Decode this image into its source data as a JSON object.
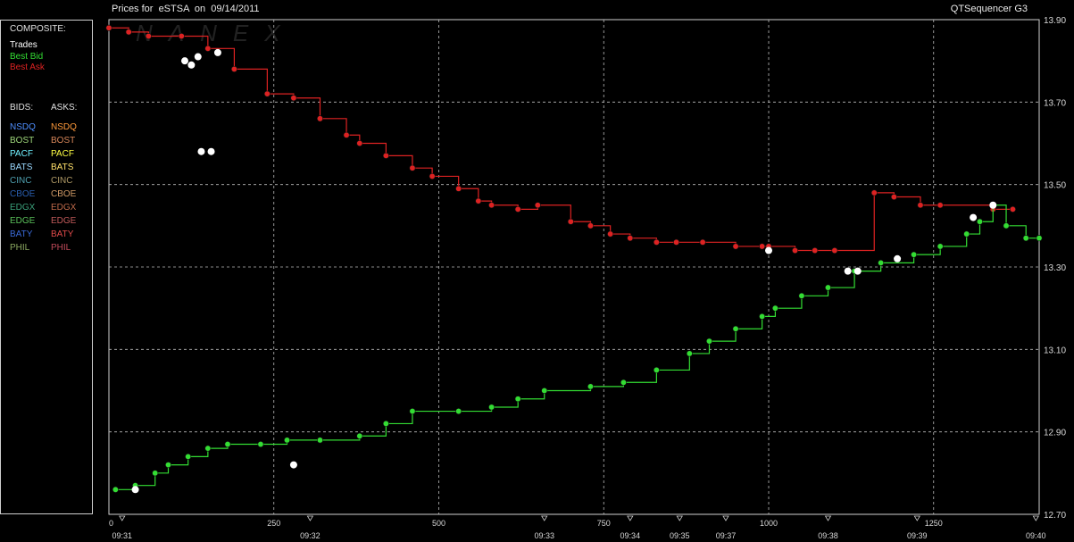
{
  "header": {
    "title": "Prices for  eSTSA  on  09/14/2011",
    "app_name": "QTSequencer G3"
  },
  "legend": {
    "composite_label": "COMPOSITE:",
    "composite": [
      {
        "label": "Trades",
        "color": "#ffffff"
      },
      {
        "label": "Best Bid",
        "color": "#33dd33"
      },
      {
        "label": "Best Ask",
        "color": "#dd2222"
      }
    ],
    "bids_label": "BIDS:",
    "asks_label": "ASKS:",
    "exchanges": [
      {
        "bid": "NSDQ",
        "ask": "NSDQ",
        "bid_color": "#4f8fff",
        "ask_color": "#ff9a3a"
      },
      {
        "bid": "BOST",
        "ask": "BOST",
        "bid_color": "#9ed67a",
        "ask_color": "#d8875a"
      },
      {
        "bid": "PACF",
        "ask": "PACF",
        "bid_color": "#6ff0ff",
        "ask_color": "#ffff44"
      },
      {
        "bid": "BATS",
        "ask": "BATS",
        "bid_color": "#9ad8ff",
        "ask_color": "#ffe06a"
      },
      {
        "bid": "CINC",
        "ask": "CINC",
        "bid_color": "#4fa0b0",
        "ask_color": "#b09a66"
      },
      {
        "bid": "CBOE",
        "ask": "CBOE",
        "bid_color": "#2a5fb0",
        "ask_color": "#d09a66"
      },
      {
        "bid": "EDGX",
        "ask": "EDGX",
        "bid_color": "#3aa07a",
        "ask_color": "#c06a4a"
      },
      {
        "bid": "EDGE",
        "ask": "EDGE",
        "bid_color": "#5ac05a",
        "ask_color": "#c05a5a"
      },
      {
        "bid": "BATY",
        "ask": "BATY",
        "bid_color": "#3a6ad8",
        "ask_color": "#e04a4a"
      },
      {
        "bid": "PHIL",
        "ask": "PHIL",
        "bid_color": "#8aa860",
        "ask_color": "#c04a5a"
      }
    ]
  },
  "chart_data": {
    "type": "line",
    "ylim": [
      12.7,
      13.9
    ],
    "y_ticks": [
      "13.90",
      "13.70",
      "13.50",
      "13.30",
      "13.10",
      "12.90",
      "12.70"
    ],
    "xlim": [
      0,
      1410
    ],
    "x_ticks": [
      "0",
      "250",
      "500",
      "750",
      "1000",
      "1250"
    ],
    "time_labels": [
      {
        "x": 20,
        "label": "09:31"
      },
      {
        "x": 305,
        "label": "09:32"
      },
      {
        "x": 660,
        "label": "09:33"
      },
      {
        "x": 790,
        "label": "09:34"
      },
      {
        "x": 865,
        "label": "09:35"
      },
      {
        "x": 935,
        "label": "09:37"
      },
      {
        "x": 1090,
        "label": "09:38"
      },
      {
        "x": 1225,
        "label": "09:39"
      },
      {
        "x": 1405,
        "label": "09:40"
      }
    ],
    "watermark": "NANEX",
    "series": [
      {
        "name": "Best Ask",
        "color": "#dd2222",
        "points": [
          [
            0,
            13.88
          ],
          [
            30,
            13.87
          ],
          [
            60,
            13.86
          ],
          [
            110,
            13.86
          ],
          [
            150,
            13.83
          ],
          [
            190,
            13.78
          ],
          [
            240,
            13.72
          ],
          [
            280,
            13.71
          ],
          [
            320,
            13.66
          ],
          [
            360,
            13.62
          ],
          [
            380,
            13.6
          ],
          [
            420,
            13.57
          ],
          [
            460,
            13.54
          ],
          [
            490,
            13.52
          ],
          [
            530,
            13.49
          ],
          [
            560,
            13.46
          ],
          [
            580,
            13.45
          ],
          [
            620,
            13.44
          ],
          [
            650,
            13.45
          ],
          [
            700,
            13.41
          ],
          [
            730,
            13.4
          ],
          [
            760,
            13.38
          ],
          [
            790,
            13.37
          ],
          [
            830,
            13.36
          ],
          [
            860,
            13.36
          ],
          [
            900,
            13.36
          ],
          [
            950,
            13.35
          ],
          [
            990,
            13.35
          ],
          [
            1000,
            13.35
          ],
          [
            1040,
            13.34
          ],
          [
            1070,
            13.34
          ],
          [
            1100,
            13.34
          ],
          [
            1160,
            13.48
          ],
          [
            1190,
            13.47
          ],
          [
            1230,
            13.45
          ],
          [
            1260,
            13.45
          ],
          [
            1340,
            13.44
          ],
          [
            1370,
            13.44
          ]
        ]
      },
      {
        "name": "Best Bid",
        "color": "#33dd33",
        "points": [
          [
            10,
            12.76
          ],
          [
            40,
            12.77
          ],
          [
            70,
            12.8
          ],
          [
            90,
            12.82
          ],
          [
            120,
            12.84
          ],
          [
            150,
            12.86
          ],
          [
            180,
            12.87
          ],
          [
            230,
            12.87
          ],
          [
            270,
            12.88
          ],
          [
            320,
            12.88
          ],
          [
            380,
            12.89
          ],
          [
            420,
            12.92
          ],
          [
            460,
            12.95
          ],
          [
            530,
            12.95
          ],
          [
            580,
            12.96
          ],
          [
            620,
            12.98
          ],
          [
            660,
            13.0
          ],
          [
            730,
            13.01
          ],
          [
            780,
            13.02
          ],
          [
            830,
            13.05
          ],
          [
            880,
            13.09
          ],
          [
            910,
            13.12
          ],
          [
            950,
            13.15
          ],
          [
            990,
            13.18
          ],
          [
            1010,
            13.2
          ],
          [
            1050,
            13.23
          ],
          [
            1090,
            13.25
          ],
          [
            1130,
            13.29
          ],
          [
            1170,
            13.31
          ],
          [
            1220,
            13.33
          ],
          [
            1260,
            13.35
          ],
          [
            1300,
            13.38
          ],
          [
            1320,
            13.41
          ],
          [
            1340,
            13.45
          ],
          [
            1360,
            13.4
          ],
          [
            1390,
            13.37
          ],
          [
            1410,
            13.37
          ]
        ]
      },
      {
        "name": "Trades",
        "color": "#ffffff",
        "points": [
          [
            40,
            12.76
          ],
          [
            115,
            13.8
          ],
          [
            125,
            13.79
          ],
          [
            135,
            13.81
          ],
          [
            165,
            13.82
          ],
          [
            140,
            13.58
          ],
          [
            155,
            13.58
          ],
          [
            280,
            12.82
          ],
          [
            1000,
            13.34
          ],
          [
            1120,
            13.29
          ],
          [
            1135,
            13.29
          ],
          [
            1195,
            13.32
          ],
          [
            1310,
            13.42
          ],
          [
            1340,
            13.45
          ]
        ]
      }
    ]
  }
}
